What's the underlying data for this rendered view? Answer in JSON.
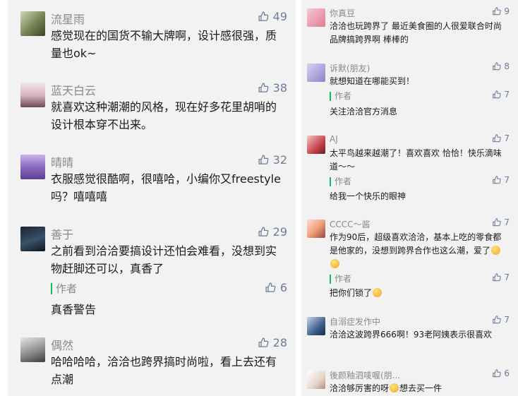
{
  "left": {
    "comments": [
      {
        "name": "流星雨",
        "likes": "49",
        "text": "感觉现在的国货不输大牌啊，设计感很强，质量也ok~"
      },
      {
        "name": "蓝天白云",
        "likes": "38",
        "text": "就喜欢这种潮潮的风格，现在好多花里胡哨的设计根本穿不出来。"
      },
      {
        "name": "晴晴",
        "likes": "32",
        "text": "衣服感觉很酷啊，很嘻哈，小编你又freestyle吗？嘻嘻嘻"
      },
      {
        "name": "善于",
        "likes": "29",
        "text": "之前看到洽洽要搞设计还怕会难看，没想到实物赶脚还可以，真香了",
        "author_label": "作者",
        "author_likes": "6",
        "author_reply": "真香警告"
      },
      {
        "name": "偶然",
        "likes": "28",
        "text": "哈哈哈哈，洽洽也跨界搞时尚啦，看上去还有点潮"
      }
    ]
  },
  "right": {
    "comments": [
      {
        "name": "你真豆",
        "likes": "9",
        "text": "洽洽也玩跨界了 最近美食圈的人很爱联合时尚品牌搞跨界啊 棒棒的"
      },
      {
        "name": "诉默(朋友)",
        "likes": "8",
        "text": "就想知道在哪能买到！",
        "author_label": "作者",
        "author_likes": "7",
        "author_reply": "关注洽洽官方消息"
      },
      {
        "name": "AJ",
        "likes": "7",
        "text": "太平鸟越来越潮了！喜欢喜欢 恰恰！快乐滴味道～～",
        "author_label": "作者",
        "author_likes": "7",
        "author_reply": "给我一个快乐的眼神"
      },
      {
        "name": "CCCC～酱",
        "likes": "7",
        "text_a": "作为90后，超级喜欢洽洽，基本上吃的零食都是他家的，没想到跨界合作也这么潮，爱了",
        "author_label": "作者",
        "author_likes": "7",
        "author_reply": "把你们锁了"
      },
      {
        "name": "自溺症发作中",
        "likes": "7",
        "text": "洽洽这波跨界666啊！93老阿姨表示很喜欢"
      },
      {
        "name": "後颜釉泗唛喔(朋...",
        "likes": "6",
        "text_a": "洽洽够厉害的呀",
        "text_b": "想去买一件"
      }
    ]
  },
  "icons": {
    "like": "thumbs-up-icon",
    "emoji": "grinning-emoji-icon"
  },
  "colors": {
    "like": "#6b7d99",
    "author_bar": "#07c160",
    "name": "#8a8a8a",
    "panel_bg": "#f2f2f2"
  }
}
